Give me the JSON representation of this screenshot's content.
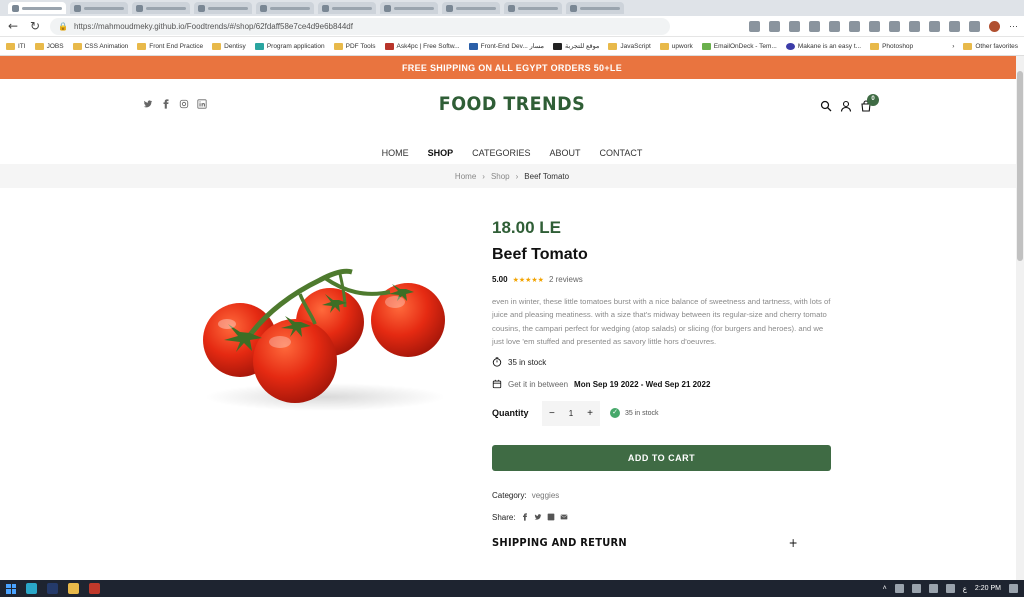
{
  "browser": {
    "url": "https://mahmoudmeky.github.io/Foodtrends/#/shop/62fdaff58e7ce4d9e6b844df",
    "bookmarks": [
      "ITI",
      "JOBS",
      "CSS Animation",
      "Front End Practice",
      "Dentisy",
      "Program application",
      "PDF Tools",
      "Ask4pc | Free Softw...",
      "Front-End Dev... مسار",
      "موقع للتجربة",
      "JavaScript",
      "upwork",
      "EmailOnDeck - Tem...",
      "Makane is an easy t...",
      "Photoshop",
      "Other favorites"
    ]
  },
  "promo": "FREE SHIPPING ON ALL EGYPT ORDERS 50+LE",
  "brand": {
    "logo": "FOOD TRENDS",
    "cart_count": "0"
  },
  "nav": {
    "items": [
      "HOME",
      "SHOP",
      "CATEGORIES",
      "ABOUT",
      "CONTACT"
    ],
    "active": "SHOP"
  },
  "breadcrumb": {
    "home": "Home",
    "shop": "Shop",
    "current": "Beef Tomato"
  },
  "product": {
    "price": "18.00 LE",
    "title": "Beef Tomato",
    "rating": "5.00",
    "rating_value": 5,
    "stars": "★★★★★",
    "reviews": "2 reviews",
    "description": "even in winter, these little tomatoes burst with a nice balance of sweetness and tartness, with lots of juice and pleasing meatiness. with a size that's midway between its regular-size and cherry tomato cousins, the campari perfect for wedging (atop salads) or slicing (for burgers and heroes). and we just love 'em stuffed and presented as savory little hors d'oeuvres.",
    "stock": "35 in stock",
    "delivery_label": "Get it in between",
    "delivery_dates": "Mon Sep 19 2022 - Wed Sep 21 2022",
    "quantity_label": "Quantity",
    "quantity": "1",
    "stock_badge": "35 in stock",
    "add_to_cart": "ADD TO CART",
    "category_label": "Category:",
    "category": "veggies",
    "share_label": "Share:",
    "shipping_title": "SHIPPING AND RETURN"
  },
  "taskbar": {
    "time": "2:20 PM",
    "lang": "ع"
  },
  "colors": {
    "brand_green": "#3f6b44",
    "promo_orange": "#e9743f",
    "star": "#f2a300"
  }
}
